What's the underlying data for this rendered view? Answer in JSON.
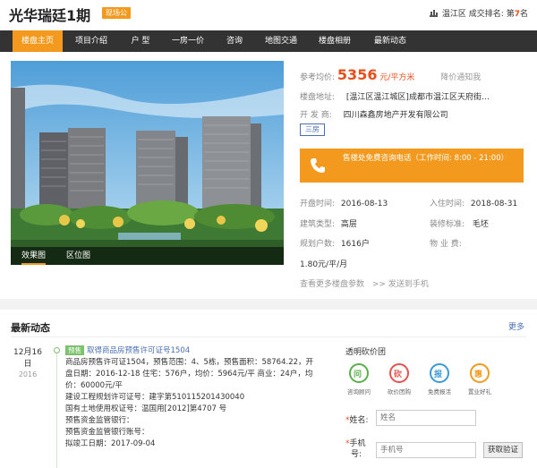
{
  "header": {
    "title": "光华瑞廷1期",
    "sale_badge": "现场公",
    "district_label": "温江区",
    "rank_label": "成交排名:",
    "rank_prefix": "第",
    "rank_number": "7",
    "rank_suffix": "名"
  },
  "nav": {
    "items": [
      "楼盘主页",
      "项目介绍",
      "户 型",
      "一房一价",
      "咨询",
      "地图交通",
      "楼盘相册",
      "最新动态"
    ]
  },
  "photo": {
    "tabs": [
      "效果图",
      "区位图"
    ]
  },
  "info": {
    "price_label": "参考均价:",
    "price_value": "5356",
    "price_unit": "元/平方米",
    "price_notify": "降价通知我",
    "address_label": "楼盘地址:",
    "address_value": "[温江区温江城区]成都市温江区天府街…",
    "developer_label": "开 发 商:",
    "developer_value": "四川森鑫房地产开发有限公司",
    "room_tag": "三房",
    "phone_text": "售楼处免费咨询电话（工作时间: 8:00 - 21:00）",
    "open_label": "开盘时间:",
    "open_value": "2016-08-13",
    "move_label": "入住时间:",
    "move_value": "2018-08-31",
    "type_label": "建筑类型:",
    "type_value": "高层",
    "deco_label": "装修标准:",
    "deco_value": "毛坯",
    "households_label": "规划户数:",
    "households_value": "1616户",
    "fee_label": "物 业 费:",
    "fee_value": "1.80元/平/月",
    "more_params": "查看更多楼盘参数",
    "send_phone": ">> 发送到手机"
  },
  "news": {
    "title": "最新动态",
    "more": "更多",
    "date_md": "12月16日",
    "date_year": "2016",
    "tag": "预售",
    "headline": "取得商品房预售许可证号1504",
    "lines": [
      "商品房预售许可证1504，预售范围：4、5栋，预售面积：58764.22，开",
      "盘日期：2016-12-18 住宅：576户，均价：5964元/平 商业：24户，均",
      "价：60000元/平",
      "建设工程规划许可证号：建字第510115201430040",
      "国有土地使用权证号：温国用[2012]第4707 号",
      "预售资金监管银行：",
      "预售资金监管银行账号：",
      "拟竣工日期：2017-09-04"
    ]
  },
  "form": {
    "title": "透明砍价团",
    "icons": [
      {
        "char": "问",
        "label": "咨询顾问",
        "color": "#5ab04a"
      },
      {
        "char": "砍",
        "label": "砍价团购",
        "color": "#e5524f"
      },
      {
        "char": "报",
        "label": "免费报活",
        "color": "#3a9ad9"
      },
      {
        "char": "惠",
        "label": "置业好礼",
        "color": "#f39a1e"
      }
    ],
    "name_label": "姓名:",
    "name_placeholder": "姓名",
    "phone_label_1": "手机",
    "phone_label_2": "号:",
    "phone_placeholder": "手机号",
    "code_button": "获取验证"
  }
}
